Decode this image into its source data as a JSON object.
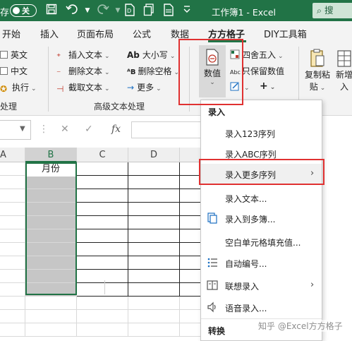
{
  "titlebar": {
    "left_partial": "存",
    "toggle_label": "关",
    "title": "工作簿1  -  Excel",
    "search_label": "搜"
  },
  "tabs": [
    "开始",
    "插入",
    "页面布局",
    "公式",
    "数据",
    "方方格子",
    "DIY工具箱"
  ],
  "ribbon": {
    "left_items": [
      "英文",
      "中文",
      "执行"
    ],
    "left_group": "处理",
    "text_col1": [
      "插入文本",
      "删除文本",
      "截取文本"
    ],
    "text_col2": [
      "大小写",
      "删除空格",
      "更多"
    ],
    "text_group": "高级文本处理",
    "numeric_button": "数值",
    "round_label": "四舍五入",
    "keep_label": "只保留数值",
    "copy_paste": [
      "复制粘",
      "贴"
    ],
    "new_button": [
      "新增",
      "入"
    ]
  },
  "formulabar": {
    "namebox": "",
    "cancel": "✕",
    "confirm": "✓",
    "fx": "fx",
    "formula": ""
  },
  "grid": {
    "columns": [
      "A",
      "B",
      "C",
      "D"
    ],
    "b1_value": "月份",
    "selected_column": "B"
  },
  "menu": {
    "section1": "录入",
    "items": [
      {
        "label": "录入123序列",
        "icon": "none"
      },
      {
        "label": "录入ABC序列",
        "icon": "none"
      },
      {
        "label": "录入更多序列",
        "icon": "none",
        "submenu": true
      },
      {
        "label": "录入文本...",
        "icon": "none"
      },
      {
        "label": "录入到多簿...",
        "icon": "multi-book-icon"
      },
      {
        "label": "空白单元格填充值...",
        "icon": "none"
      },
      {
        "label": "自动编号...",
        "icon": "numbered-list-icon"
      },
      {
        "label": "联想录入",
        "icon": "book-icon",
        "submenu": true
      },
      {
        "label": "语音录入...",
        "icon": "speaker-icon"
      }
    ],
    "section2": "转换"
  },
  "watermark": "知乎 @Excel方方格子",
  "colors": {
    "excel_green": "#217346",
    "highlight_red": "#e03131",
    "selection_gray": "#c6c6c6"
  }
}
